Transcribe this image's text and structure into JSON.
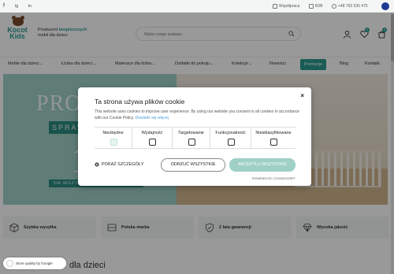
{
  "topbar": {
    "links": [
      {
        "label": "Współpraca",
        "icon": "handshake-icon"
      },
      {
        "label": "B2B",
        "icon": "b2b-icon"
      },
      {
        "label": "+48 793 530 475",
        "icon": "phone-icon"
      }
    ],
    "socials": [
      "f",
      "ig",
      "in"
    ]
  },
  "header": {
    "logo_line1": "Kocot",
    "logo_line2": "Kids",
    "tagline_pre": "Producent ",
    "tagline_accent": "bezpiecznych",
    "tagline_post": "mebli dla dzieci",
    "search_placeholder": "Wpisz czego szukasz",
    "wishlist_count": "0",
    "cart_count": "0"
  },
  "nav": {
    "items": [
      {
        "label": "Meble dla dzieci",
        "chev": "⌄"
      },
      {
        "label": "Łóżka dla dzieci",
        "chev": "⌄"
      },
      {
        "label": "Materace dla łóżka",
        "chev": "⌄"
      },
      {
        "label": "Dodatki do pokoju",
        "chev": "⌄"
      },
      {
        "label": "Kolekcje",
        "chev": "⌄"
      },
      {
        "label": "Nowości",
        "chev": ""
      },
      {
        "label": "Promocje",
        "chev": ""
      },
      {
        "label": "Blog",
        "chev": ""
      },
      {
        "label": "Kontakt",
        "chev": ""
      }
    ]
  },
  "hero": {
    "big": "PRO",
    "sprawdz": "SPRAW",
    "num": "1",
    "wszy": "NA WSZY"
  },
  "features": [
    {
      "label": "Szybka wysyłka",
      "icon": "box-icon"
    },
    {
      "label": "Polska marka",
      "icon": "flag-icon"
    },
    {
      "label": "2 lata gwarancji",
      "icon": "shield-icon"
    },
    {
      "label": "Wysoka jakość",
      "icon": "diamond-icon"
    }
  ],
  "section_title": "dla dzieci",
  "google_badge": "Store quality by Google",
  "cookie": {
    "title": "Ta strona używa plików cookie",
    "desc": "This website uses cookies to improve user experience. By using our website you consent to all cookies in accordance with our Cookie Policy.",
    "more": "Dowiedz się więcej",
    "categories": [
      {
        "label": "Niezbędne",
        "checked": true,
        "disabled": true
      },
      {
        "label": "Wydajność",
        "checked": false,
        "disabled": false
      },
      {
        "label": "Targetowanie",
        "checked": false,
        "disabled": false
      },
      {
        "label": "Funkcjonalność",
        "checked": false,
        "disabled": false
      },
      {
        "label": "Niesklasyfikowane",
        "checked": false,
        "disabled": false
      }
    ],
    "show_details": "POKAŻ SZCZEGÓŁY",
    "reject": "ODRZUĆ WSZYSTKIE",
    "accept": "AKCEPTUJ WSZYSTKIE",
    "powered": "POWERED BY COOKIESCRIPT",
    "close": "×"
  },
  "colors": {
    "accent": "#2b9a8e",
    "accept_button": "#9fd0c6",
    "overlay": "rgba(0,0,0,0.40)"
  }
}
